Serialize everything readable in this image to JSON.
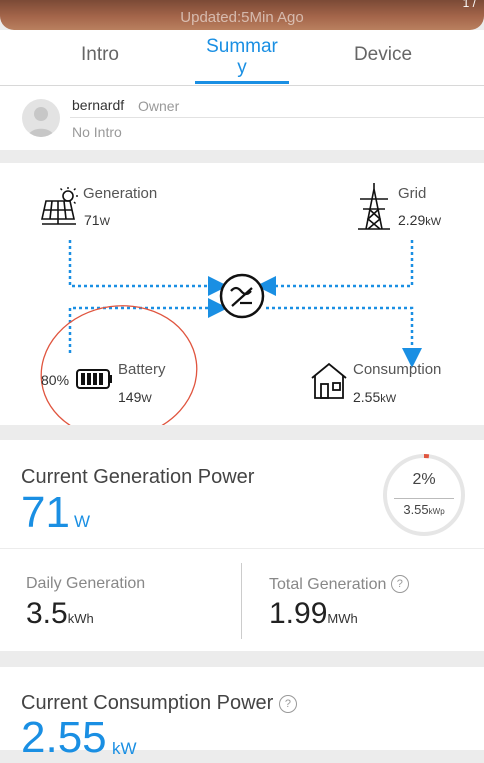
{
  "header": {
    "updated_text": "Updated:5Min Ago",
    "corner_text": "1 /"
  },
  "tabs": [
    {
      "label_line1": "Intro",
      "label_line2": ""
    },
    {
      "label_line1": "Summar",
      "label_line2": "y"
    },
    {
      "label_line1": "Device",
      "label_line2": ""
    }
  ],
  "owner": {
    "name": "bernardf",
    "role": "Owner",
    "intro": "No Intro"
  },
  "flow": {
    "generation": {
      "label": "Generation",
      "value": "71",
      "unit": "W"
    },
    "grid": {
      "label": "Grid",
      "value": "2.29",
      "unit": "kW"
    },
    "battery": {
      "label": "Battery",
      "value": "149",
      "unit": "W",
      "soc": "80%"
    },
    "consumption": {
      "label": "Consumption",
      "value": "2.55",
      "unit": "kW"
    }
  },
  "generation_power": {
    "title": "Current Generation Power",
    "value": "71",
    "unit": "W",
    "ring": {
      "percent_text": "2%",
      "capacity_value": "3.55",
      "capacity_unit": "kWp",
      "fraction": 0.02
    }
  },
  "stats": {
    "daily": {
      "label": "Daily Generation",
      "value": "3.5",
      "unit": "kWh"
    },
    "total": {
      "label": "Total Generation",
      "value": "1.99",
      "unit": "MWh"
    }
  },
  "consumption_power": {
    "title": "Current Consumption Power",
    "value": "2.55",
    "unit": "kW"
  },
  "colors": {
    "accent": "#1a8fe3",
    "annotation": "#e0553f"
  }
}
